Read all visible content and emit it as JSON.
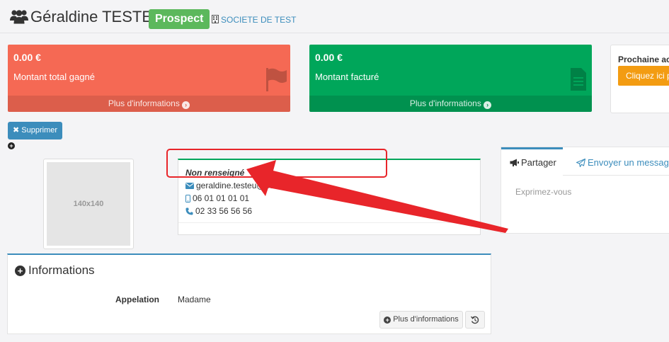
{
  "header": {
    "title": "Géraldine TESTEU",
    "status_badge": "Prospect",
    "company": "SOCIETE DE TEST"
  },
  "boxes": {
    "won": {
      "amount": "0.00 €",
      "label": "Montant total gagné",
      "more": "Plus d'informations",
      "color": "#f56954"
    },
    "billed": {
      "amount": "0.00 €",
      "label": "Montant facturé",
      "more": "Plus d'informations",
      "color": "#00a65a"
    },
    "next_action": {
      "title": "Prochaine act",
      "button": "Cliquez ici p"
    }
  },
  "actions": {
    "delete": "Supprimer"
  },
  "avatar": {
    "placeholder": "140x140"
  },
  "contact": {
    "name": "Non renseigné",
    "email": "geraldine.testeu@societe.",
    "mobile": "06 01 01 01 01",
    "phone": "02 33 56 56 56"
  },
  "share": {
    "tab_share": "Partager",
    "tab_message": "Envoyer un message",
    "placeholder": "Exprimez-vous"
  },
  "informations": {
    "title": "Informations",
    "field_label": "Appelation",
    "field_value": "Madame",
    "more_button": "Plus d'informations"
  },
  "colors": {
    "primary": "#3c8dbc",
    "success": "#5cb85c",
    "warning": "#f39c12",
    "annotation": "#e8252a"
  }
}
